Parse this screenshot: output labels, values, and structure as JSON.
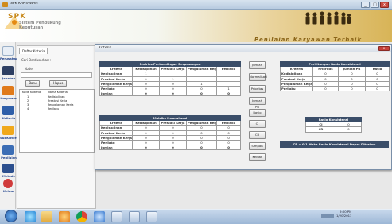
{
  "window": {
    "title": "SPK KARYAWAN",
    "min": "_",
    "max": "□",
    "close": "x"
  },
  "banner": {
    "logo_text": "SPK",
    "subtitle_line1": "Sistem Pendukung",
    "subtitle_line2": "Keputusan",
    "tagline": "Penilaian Karyawan Terbaik"
  },
  "nav": {
    "items": [
      "Perusahaan",
      "Jabatan",
      "Karyawan",
      "Kriteria",
      "SubKriteria",
      "Penilaian",
      "Metode",
      "Keluar"
    ]
  },
  "subpanel": {
    "tab": "Daftar Kriteria",
    "search_label": "Cari Berdasarkan :",
    "kode_label": "Kode",
    "btn_baru": "Baru",
    "btn_hapus": "Hapus",
    "list_headers": [
      "Kode Kriteria",
      "Nama Kriteria"
    ],
    "list_rows": [
      [
        "1",
        "Kedisiplinan"
      ],
      [
        "2",
        "Prestasi Kerja"
      ],
      [
        "3",
        "Pengalaman Kerja"
      ],
      [
        "4",
        "Perilaku"
      ]
    ]
  },
  "dialog": {
    "title": "Kriteria",
    "close": "x",
    "pairwise": {
      "caption": "Matriks Perbandingan Berpasangan",
      "headers": [
        "Kriteria",
        "Kedisiplinan",
        "Prestasi Kerja",
        "Pengalaman Kerja",
        "Perilaku"
      ],
      "rows": [
        [
          "Kedisiplinan",
          "1",
          "",
          "",
          ""
        ],
        [
          "Prestasi Kerja",
          "0",
          "1",
          "",
          ""
        ],
        [
          "Pengalaman Kerja",
          "0",
          "0",
          "1",
          ""
        ],
        [
          "Perilaku",
          "0",
          "0",
          "0",
          "1"
        ],
        [
          "Jumlah",
          "0",
          "0",
          "0",
          "0"
        ]
      ]
    },
    "normal": {
      "caption": "Matriks Normalisasi",
      "headers": [
        "Kriteria",
        "Kedisiplinan",
        "Prestasi Kerja",
        "Pengalaman Kerja",
        "Perilaku"
      ],
      "rows": [
        [
          "Kedisiplinan",
          "0",
          "0",
          "0",
          "0"
        ],
        [
          "Prestasi Kerja",
          "0",
          "0",
          "0",
          "0"
        ],
        [
          "Pengalaman Kerja",
          "0",
          "0",
          "0",
          "0"
        ],
        [
          "Perilaku",
          "0",
          "0",
          "0",
          "0"
        ],
        [
          "Jumlah",
          "0",
          "0",
          "0",
          "0"
        ]
      ]
    },
    "buttons": [
      "Jumlah",
      "Normalisasi",
      "Prioritas",
      "Jumlah PR",
      "Rasio",
      "CI",
      "CR",
      "Simpan",
      "Keluar"
    ],
    "ratio": {
      "caption": "Perhitungan Rasio Konsistensi",
      "headers": [
        "Kriteria",
        "Prioritas",
        "Jumlah PR",
        "Rasio"
      ],
      "rows": [
        [
          "Kedisiplinan",
          "0",
          "0",
          "0"
        ],
        [
          "Prestasi Kerja",
          "0",
          "0",
          "0"
        ],
        [
          "Pengalaman Kerja",
          "0",
          "0",
          "0"
        ],
        [
          "Perilaku",
          "0",
          "0",
          "0"
        ]
      ]
    },
    "consistency": {
      "caption": "Rasio Konsistensi",
      "rows": [
        [
          "CI",
          "0"
        ],
        [
          "CR",
          "0"
        ]
      ]
    },
    "cr_note": "CR < 0.1 Maka Rasio Konsistensi Dapat Diterima"
  },
  "taskbar": {
    "time": "9:00 PM",
    "date": "1/20/2013"
  },
  "colors": {
    "table_header": "#3b4e69",
    "banner_gold": "#d8b457"
  }
}
